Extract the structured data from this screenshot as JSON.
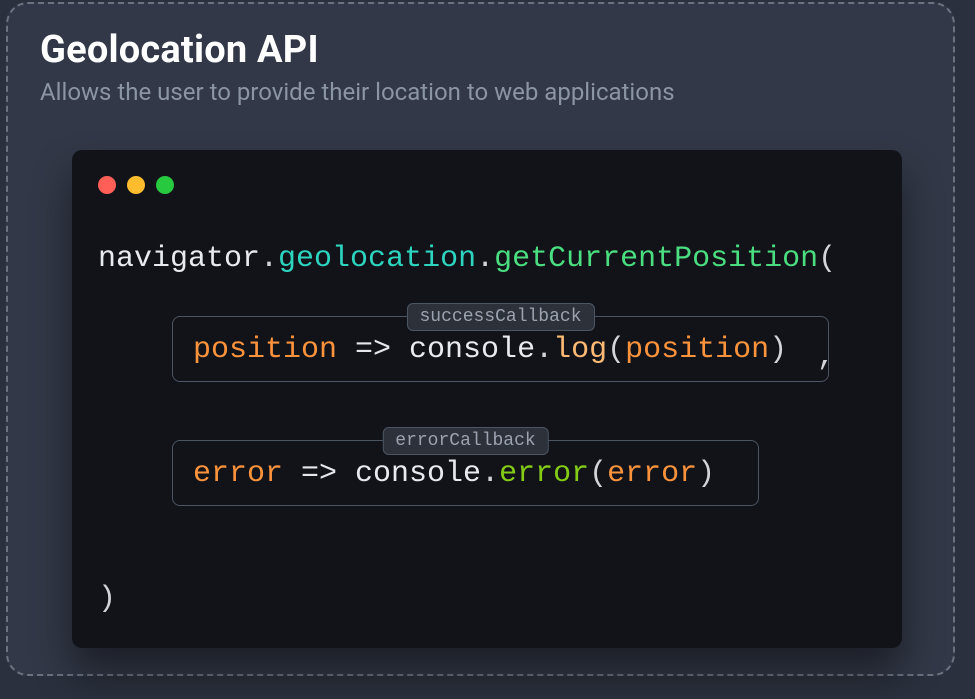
{
  "title": "Geolocation API",
  "subtitle": "Allows the user to provide their location to web applications",
  "code": {
    "line1": {
      "navigator": "navigator",
      "dot1": ".",
      "geolocation": "geolocation",
      "dot2": ".",
      "method": "getCurrentPosition",
      "open": "("
    },
    "callback1": {
      "label": "successCallback",
      "param": "position",
      "arrow": " => ",
      "console": "console",
      "dot": ".",
      "fn": "log",
      "open": "(",
      "arg": "position",
      "close": ")"
    },
    "comma": ",",
    "callback2": {
      "label": "errorCallback",
      "param": "error",
      "arrow": " => ",
      "console": "console",
      "dot": ".",
      "fn": "error",
      "open": "(",
      "arg": "error",
      "close": ")"
    },
    "close": ")"
  }
}
